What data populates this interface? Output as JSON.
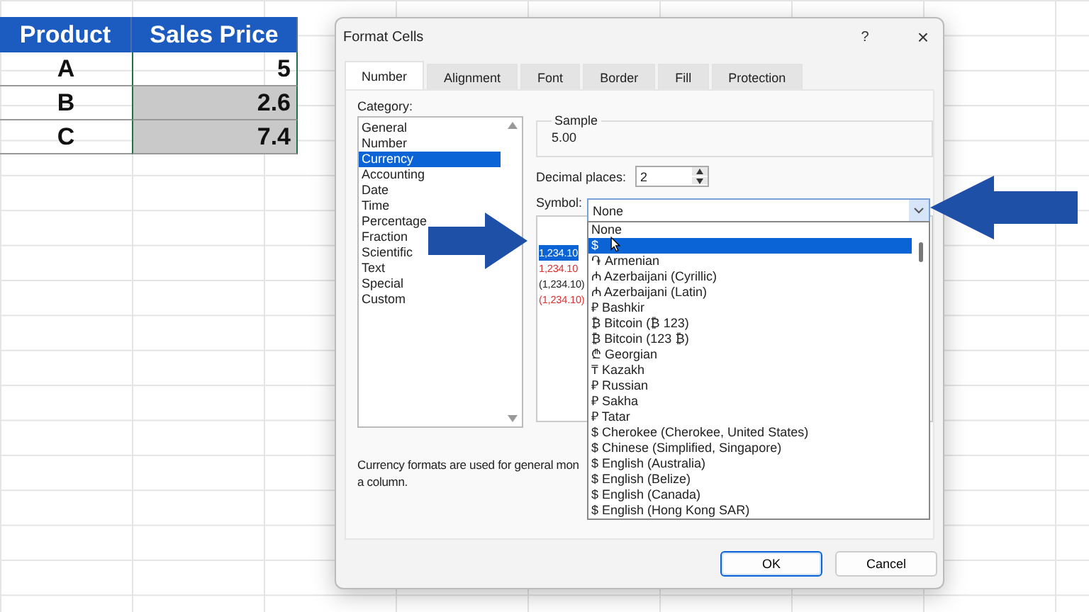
{
  "sheet": {
    "columns": [
      "Product",
      "Sales Price"
    ],
    "rows": [
      {
        "product": "A",
        "price": "5",
        "highlighted": false
      },
      {
        "product": "B",
        "price": "2.6",
        "highlighted": true
      },
      {
        "product": "C",
        "price": "7.4",
        "highlighted": true
      }
    ]
  },
  "dialog": {
    "title": "Format Cells",
    "help": "?",
    "close": "×",
    "tabs": [
      {
        "label": "Number",
        "selected": true
      },
      {
        "label": "Alignment",
        "selected": false
      },
      {
        "label": "Font",
        "selected": false
      },
      {
        "label": "Border",
        "selected": false
      },
      {
        "label": "Fill",
        "selected": false
      },
      {
        "label": "Protection",
        "selected": false
      }
    ],
    "category_label": "Category:",
    "categories": [
      {
        "label": "General",
        "selected": false
      },
      {
        "label": "Number",
        "selected": false
      },
      {
        "label": "Currency",
        "selected": true
      },
      {
        "label": "Accounting",
        "selected": false
      },
      {
        "label": "Date",
        "selected": false
      },
      {
        "label": "Time",
        "selected": false
      },
      {
        "label": "Percentage",
        "selected": false
      },
      {
        "label": "Fraction",
        "selected": false
      },
      {
        "label": "Scientific",
        "selected": false
      },
      {
        "label": "Text",
        "selected": false
      },
      {
        "label": "Special",
        "selected": false
      },
      {
        "label": "Custom",
        "selected": false
      }
    ],
    "sample_label": "Sample",
    "sample_value": "5.00",
    "decimal_label": "Decimal places:",
    "decimal_value": "2",
    "symbol_label": "Symbol:",
    "symbol_value": "None",
    "negative_numbers": [
      {
        "text": "1,234.10",
        "red": false,
        "selected": true
      },
      {
        "text": "1,234.10",
        "red": true,
        "selected": false
      },
      {
        "text": "(1,234.10)",
        "red": false,
        "selected": false
      },
      {
        "text": "(1,234.10)",
        "red": true,
        "selected": false
      }
    ],
    "description_lines": [
      "Currency formats are used for general mon",
      "a column."
    ],
    "symbol_options": [
      {
        "label": "None",
        "selected": false
      },
      {
        "label": "$",
        "selected": true
      },
      {
        "label": "֏ Armenian",
        "selected": false
      },
      {
        "label": "₼ Azerbaijani (Cyrillic)",
        "selected": false
      },
      {
        "label": "₼ Azerbaijani (Latin)",
        "selected": false
      },
      {
        "label": "₽ Bashkir",
        "selected": false
      },
      {
        "label": "₿ Bitcoin (₿ 123)",
        "selected": false
      },
      {
        "label": "₿ Bitcoin (123 ₿)",
        "selected": false
      },
      {
        "label": "₾ Georgian",
        "selected": false
      },
      {
        "label": "₸ Kazakh",
        "selected": false
      },
      {
        "label": "₽ Russian",
        "selected": false
      },
      {
        "label": "₽ Sakha",
        "selected": false
      },
      {
        "label": "₽ Tatar",
        "selected": false
      },
      {
        "label": "$ Cherokee (Cherokee, United States)",
        "selected": false
      },
      {
        "label": "$ Chinese (Simplified, Singapore)",
        "selected": false
      },
      {
        "label": "$ English (Australia)",
        "selected": false
      },
      {
        "label": "$ English (Belize)",
        "selected": false
      },
      {
        "label": "$ English (Canada)",
        "selected": false
      },
      {
        "label": "$ English (Hong Kong SAR)",
        "selected": false
      }
    ],
    "buttons": [
      {
        "label": "OK",
        "kind": "primary"
      },
      {
        "label": "Cancel",
        "kind": "secondary"
      }
    ]
  }
}
